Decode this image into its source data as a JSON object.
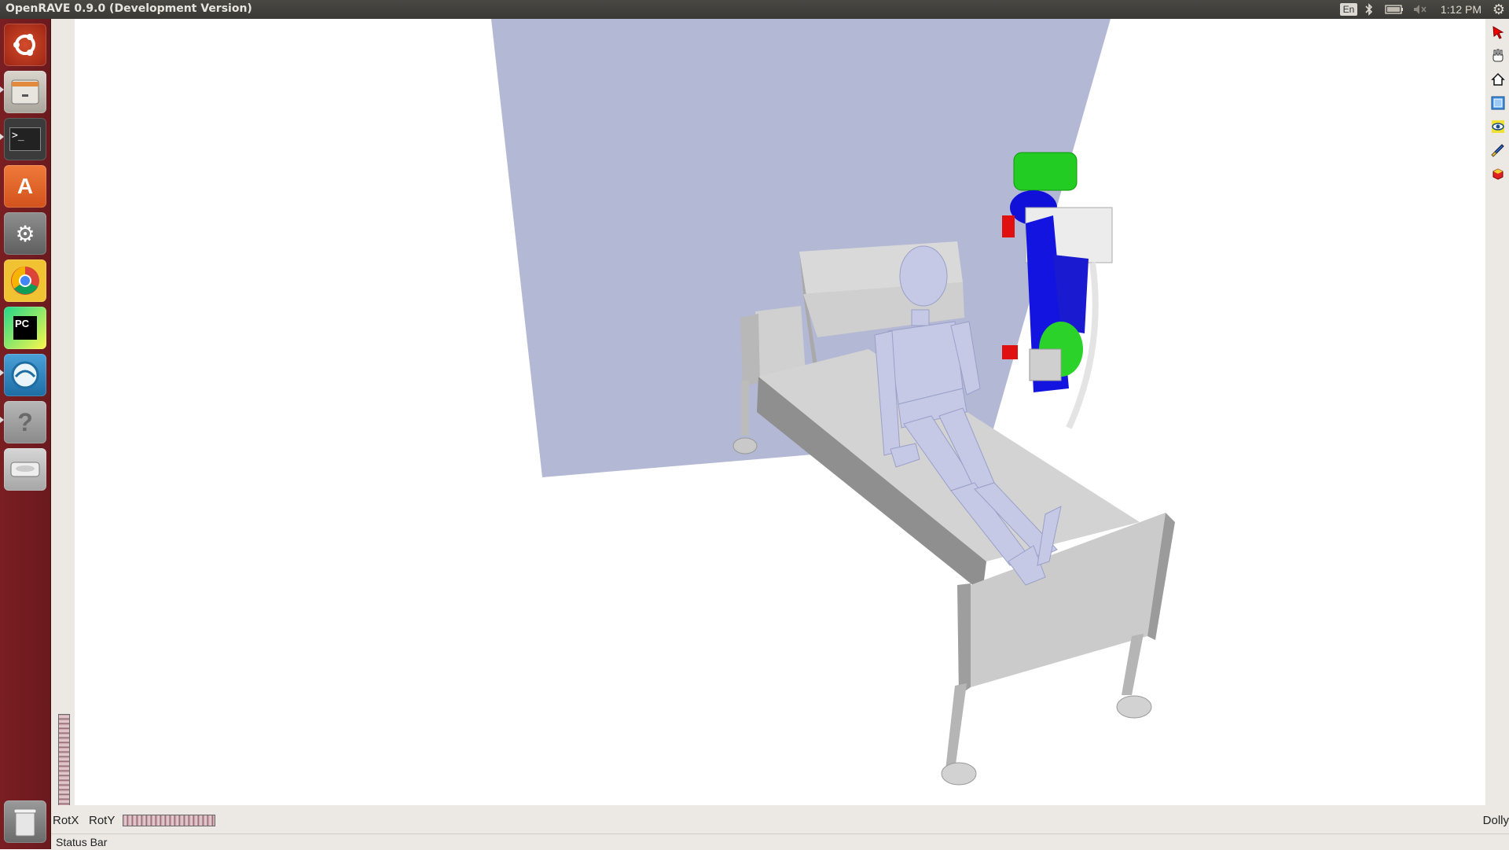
{
  "window": {
    "title": "OpenRAVE 0.9.0 (Development Version)"
  },
  "tray": {
    "language": "En",
    "bluetooth_icon": "bluetooth-icon",
    "battery_icon": "battery-icon",
    "volume_icon": "volume-muted-icon",
    "clock": "1:12 PM",
    "settings_icon": "gear-icon"
  },
  "launcher": {
    "items": [
      {
        "name": "ubuntu-dash",
        "icon": "ubuntu-logo-icon"
      },
      {
        "name": "files",
        "icon": "file-cabinet-icon"
      },
      {
        "name": "terminal",
        "icon": "terminal-icon",
        "glyph": ">_"
      },
      {
        "name": "software-center",
        "icon": "shopping-bag-icon",
        "glyph": "A"
      },
      {
        "name": "system-settings",
        "icon": "wrench-gear-icon"
      },
      {
        "name": "chrome",
        "icon": "chrome-icon"
      },
      {
        "name": "pycharm",
        "icon": "pycharm-icon",
        "glyph": "PC"
      },
      {
        "name": "network-app",
        "icon": "globe-arrow-icon"
      },
      {
        "name": "unknown-app",
        "icon": "question-mark-icon",
        "glyph": "?"
      },
      {
        "name": "drive",
        "icon": "hard-drive-icon"
      },
      {
        "name": "trash",
        "icon": "trash-icon"
      }
    ],
    "colors": {
      "background": "#7a1e22"
    }
  },
  "viewer_tools": [
    {
      "name": "select",
      "icon": "cursor-arrow-icon"
    },
    {
      "name": "pan",
      "icon": "hand-icon"
    },
    {
      "name": "home",
      "icon": "home-icon"
    },
    {
      "name": "view-all",
      "icon": "view-all-icon"
    },
    {
      "name": "seek",
      "icon": "eye-icon"
    },
    {
      "name": "collision",
      "icon": "brush-icon"
    },
    {
      "name": "camera",
      "icon": "camera-icon"
    }
  ],
  "bottom_controls": {
    "rotx": "RotX",
    "roty": "RotY",
    "dolly": "Dolly"
  },
  "status_bar": {
    "text": "Status Bar"
  }
}
